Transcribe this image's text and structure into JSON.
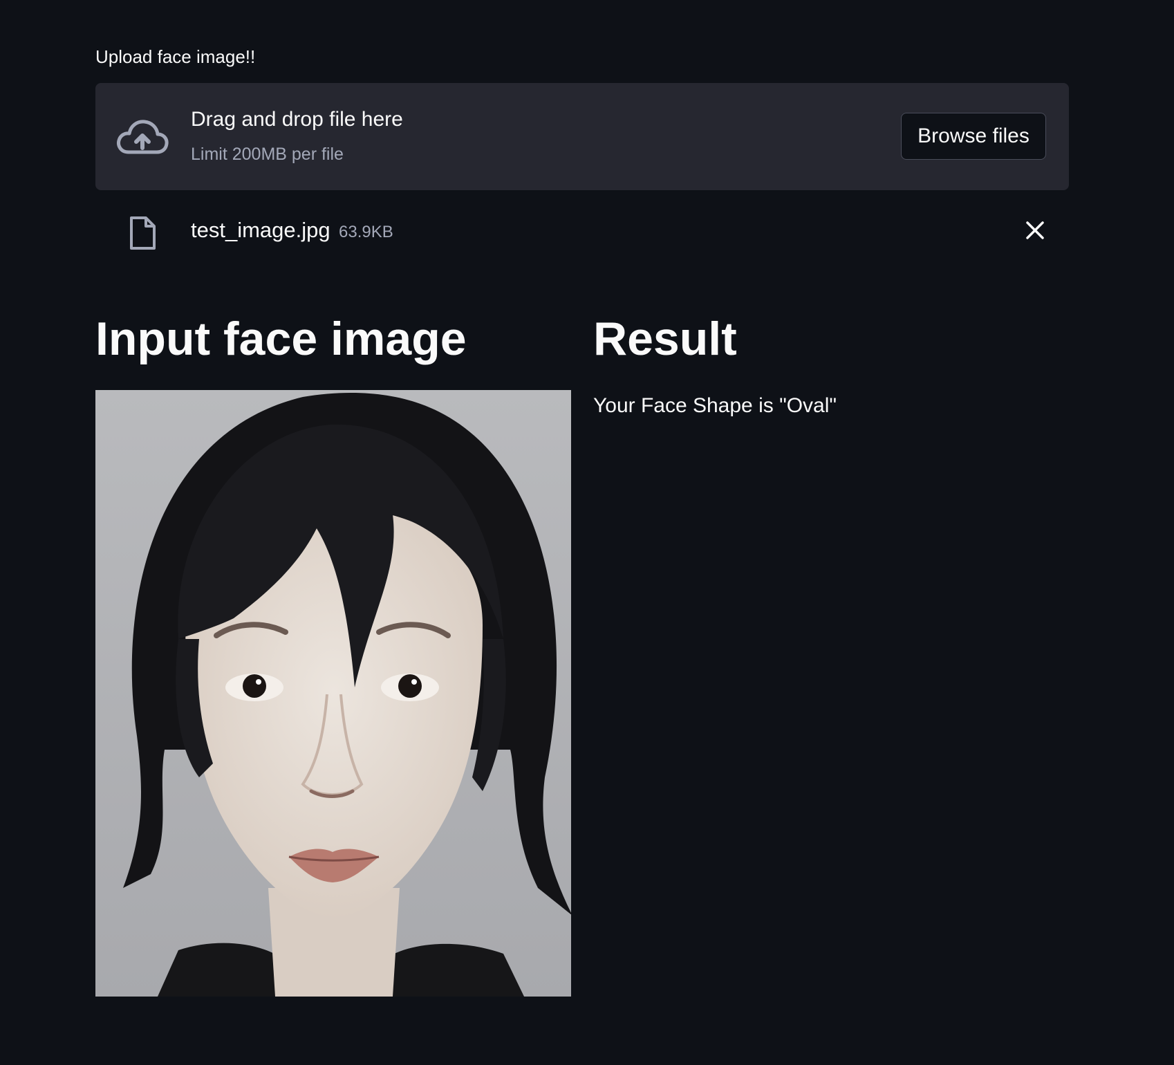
{
  "uploader": {
    "label": "Upload face image!!",
    "drop_title": "Drag and drop file here",
    "drop_limit": "Limit 200MB per file",
    "browse_label": "Browse files",
    "icon": "cloud-upload-icon"
  },
  "uploaded_file": {
    "name": "test_image.jpg",
    "size": "63.9KB",
    "icon": "file-icon",
    "remove_icon": "close-icon"
  },
  "columns": {
    "left": {
      "heading": "Input face image"
    },
    "right": {
      "heading": "Result",
      "result_text": "Your Face Shape is \"Oval\""
    }
  },
  "colors": {
    "background": "#0e1117",
    "dropzone": "#262730",
    "text": "#fafafa",
    "muted_text": "#a3a8b8"
  }
}
